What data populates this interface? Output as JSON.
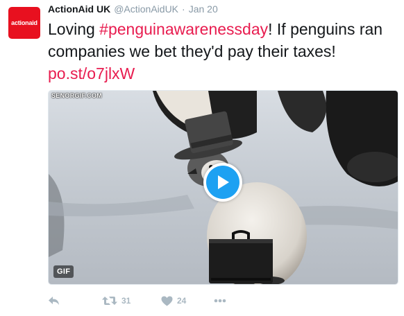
{
  "account": {
    "display_name": "ActionAid UK",
    "handle": "@ActionAidUK",
    "separator": "·",
    "timestamp": "Jan 20",
    "avatar_text": "actionaid"
  },
  "tweet": {
    "text_before": "Loving ",
    "hashtag": "#penguinawarenessday",
    "text_after": "! If penguins ran companies we bet they'd pay their taxes! ",
    "link": "po.st/o7jlxW"
  },
  "media": {
    "watermark": "SENORGIF.COM",
    "badge": "GIF",
    "play_icon": "play-icon"
  },
  "actions": {
    "reply_icon": "reply-icon",
    "retweet_icon": "retweet-icon",
    "retweet_count": "31",
    "like_icon": "heart-icon",
    "like_count": "24",
    "more_icon": "more-icon"
  },
  "colors": {
    "brand_red": "#e8101f",
    "link_color": "#e81c4f",
    "play_blue": "#1da1f2",
    "muted": "#8899a6",
    "action_grey": "#aab8c2"
  }
}
